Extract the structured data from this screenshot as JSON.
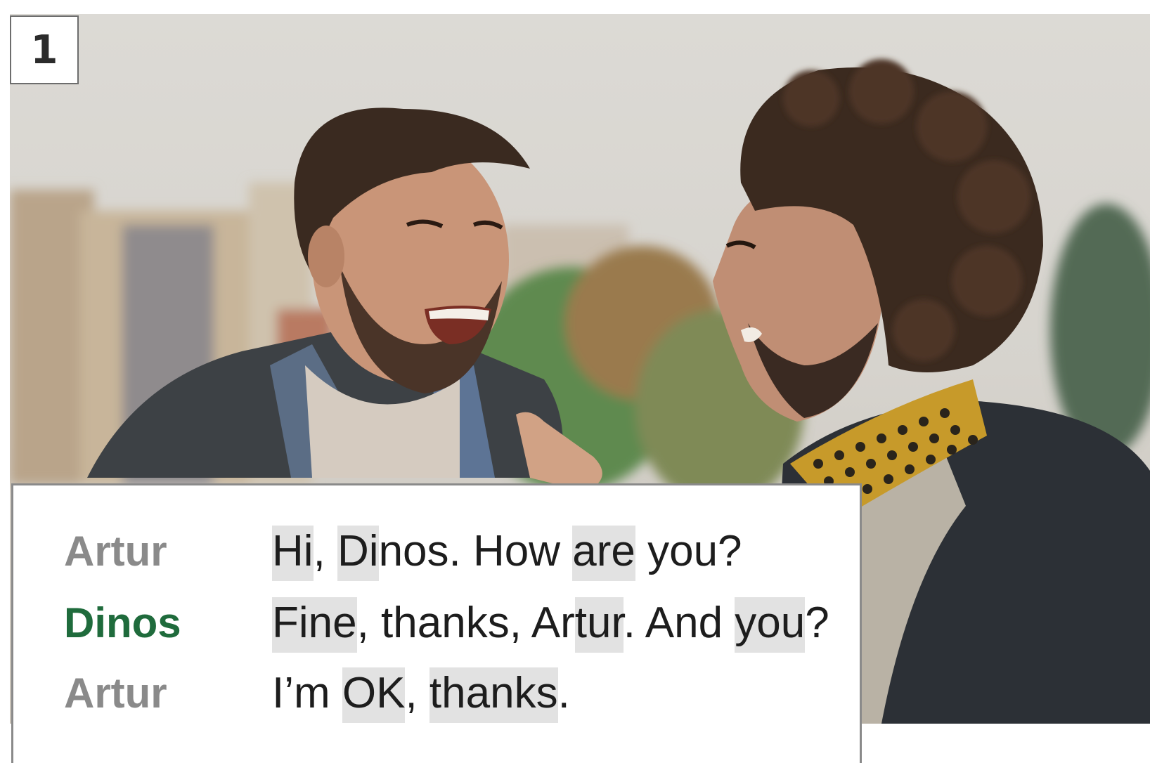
{
  "exercise": {
    "number": "1"
  },
  "photo": {
    "description_icon": "two-men-laughing-photo"
  },
  "dialogue": {
    "lines": [
      {
        "speaker": "Artur",
        "speaker_color": "#8a8a8a",
        "segments": [
          {
            "text": "Hi",
            "highlight": true
          },
          {
            "text": ", ",
            "highlight": false
          },
          {
            "text": "Di",
            "highlight": true
          },
          {
            "text": "nos. How ",
            "highlight": false
          },
          {
            "text": "are",
            "highlight": true
          },
          {
            "text": " you?",
            "highlight": false
          }
        ]
      },
      {
        "speaker": "Dinos",
        "speaker_color": "#1f6b3c",
        "segments": [
          {
            "text": "Fine",
            "highlight": true
          },
          {
            "text": ", thanks, Ar",
            "highlight": false
          },
          {
            "text": "tur",
            "highlight": true
          },
          {
            "text": ". And ",
            "highlight": false
          },
          {
            "text": "you",
            "highlight": true
          },
          {
            "text": "?",
            "highlight": false
          }
        ]
      },
      {
        "speaker": "Artur",
        "speaker_color": "#8a8a8a",
        "segments": [
          {
            "text": "I’m ",
            "highlight": false
          },
          {
            "text": "OK",
            "highlight": true
          },
          {
            "text": ", ",
            "highlight": false
          },
          {
            "text": "thanks",
            "highlight": true
          },
          {
            "text": ".",
            "highlight": false
          }
        ]
      }
    ]
  }
}
